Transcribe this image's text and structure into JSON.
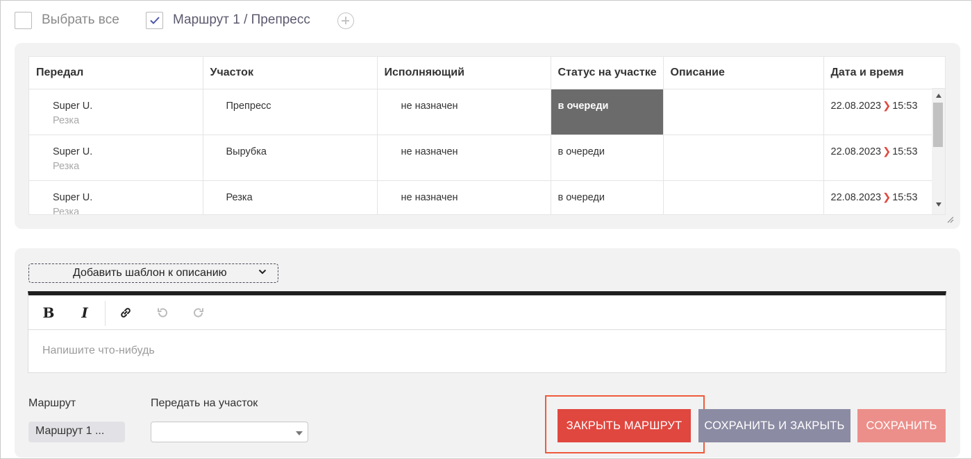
{
  "top": {
    "select_all_label": "Выбрать все",
    "select_all_checked": false,
    "route_label": "Маршрут 1 / Препресс",
    "route_checked": true
  },
  "table": {
    "columns": [
      "Передал",
      "Участок",
      "Исполняющий",
      "Статус на участке",
      "Описание",
      "Дата и время"
    ],
    "rows": [
      {
        "sender": "Super U.",
        "sender_sub": "Резка",
        "section": "Препресс",
        "assignee": "не назначен",
        "status": "в очереди",
        "status_active": true,
        "description": "",
        "date": "22.08.2023",
        "date_arrow": "❯",
        "time": "15:53"
      },
      {
        "sender": "Super U.",
        "sender_sub": "Резка",
        "section": "Вырубка",
        "assignee": "не назначен",
        "status": "в очереди",
        "status_active": false,
        "description": "",
        "date": "22.08.2023",
        "date_arrow": "❯",
        "time": "15:53"
      },
      {
        "sender": "Super U.",
        "sender_sub": "Резка",
        "section": "Резка",
        "assignee": "не назначен",
        "status": "в очереди",
        "status_active": false,
        "description": "",
        "date": "22.08.2023",
        "date_arrow": "❯",
        "time": "15:53"
      }
    ]
  },
  "editor": {
    "template_select_label": "Добавить шаблон к описанию",
    "toolbar": {
      "bold": "B",
      "italic": "I",
      "link_icon": "link-icon",
      "undo_icon": "undo-icon",
      "redo_icon": "redo-icon"
    },
    "placeholder": "Напишите что-нибудь"
  },
  "form": {
    "route_label": "Маршрут",
    "route_value": "Маршрут 1 ...",
    "transfer_label": "Передать на участок",
    "transfer_value": ""
  },
  "buttons": {
    "close_route": "ЗАКРЫТЬ МАРШРУТ",
    "save_and_close": "СОХРАНИТЬ И ЗАКРЫТЬ",
    "save": "СОХРАНИТЬ"
  },
  "colors": {
    "accent_red": "#e0473f",
    "secondary": "#8b8ba3",
    "disabled_red": "#ec8f8a",
    "status_active_bg": "#6b6b6b",
    "highlight": "#ee5a3c"
  }
}
